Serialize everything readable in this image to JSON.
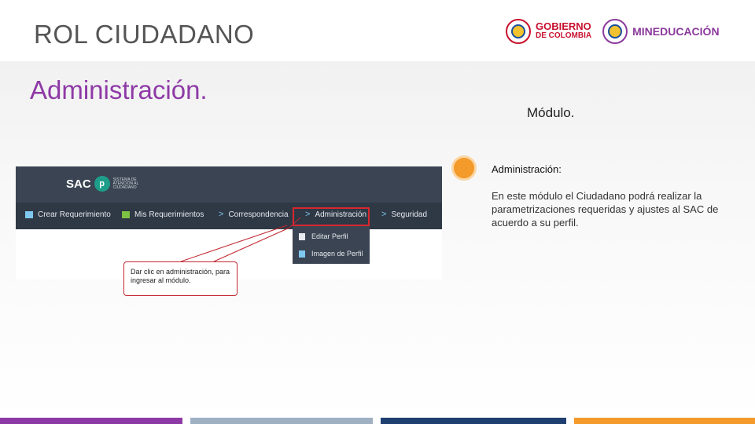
{
  "header": {
    "title": "ROL CIUDADANO",
    "logo_gov_line1": "GOBIERNO",
    "logo_gov_line2": "DE COLOMBIA",
    "logo_min": "MINEDUCACIÓN"
  },
  "section": {
    "title": "Administración."
  },
  "module": {
    "heading": "Módulo.",
    "label": "Administración:",
    "description": "En este módulo el Ciudadano podrá realizar la parametrizaciones requeridas y ajustes al SAC de acuerdo a su perfil."
  },
  "screenshot": {
    "logo_text": "SAC",
    "logo_subtitle": "SISTEMA DE ATENCIÓN AL CIUDADANO",
    "nav": [
      {
        "label": "Crear Requerimiento",
        "icon": "form-icon"
      },
      {
        "label": "Mis Requerimientos",
        "icon": "grid-icon"
      },
      {
        "label": "Correspondencia",
        "icon": "arrow-icon"
      },
      {
        "label": "Administración",
        "icon": "arrow-icon"
      },
      {
        "label": "Seguridad",
        "icon": "arrow-icon"
      }
    ],
    "dropdown": [
      {
        "label": "Editar Perfil",
        "icon": "document-icon"
      },
      {
        "label": "Imagen de Perfil",
        "icon": "image-icon"
      }
    ]
  },
  "callout": {
    "text": "Dar clic en administración, para ingresar al módulo."
  },
  "colors": {
    "title_gray": "#555555",
    "section_purple": "#8e3aa6",
    "orange": "#f39a2a",
    "nav_dark": "#2f3845",
    "highlight_red": "#d8282f",
    "strip_purple": "#8e3aa6",
    "strip_gray": "#9fb0c3",
    "strip_blue": "#1f3f70",
    "strip_orange": "#f39a2a"
  }
}
